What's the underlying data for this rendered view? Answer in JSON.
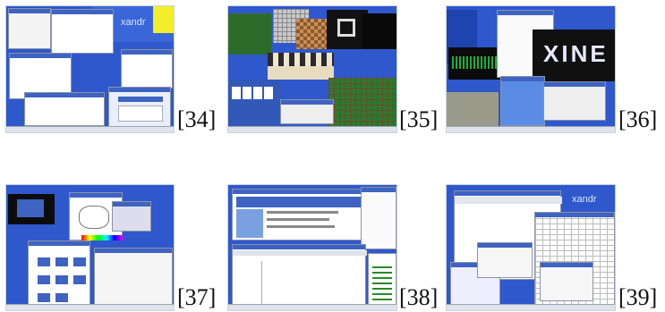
{
  "captions": [
    "[34]",
    "[35]",
    "[36]",
    "[37]",
    "[38]",
    "[39]"
  ],
  "logos": {
    "xandros_a": "xandr",
    "xine": "XINE",
    "xandros_b": "xandr"
  },
  "colors": {
    "desktop_blue": "#2b52c8",
    "titlebar_blue": "#3e63c2",
    "highlight_yellow": "#f2ee2a",
    "game_green": "#2d6b2a"
  }
}
